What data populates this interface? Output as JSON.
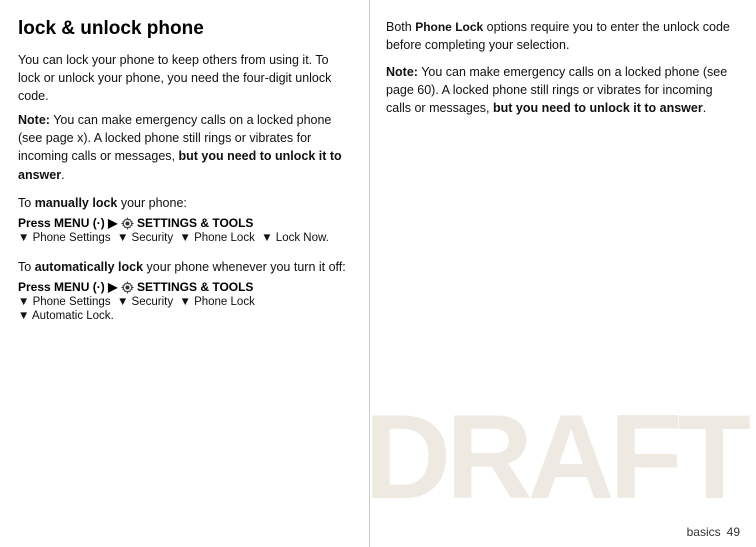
{
  "page": {
    "title": "lock & unlock phone",
    "draft_watermark": "DRAFT",
    "page_number": "49",
    "page_label": "basics"
  },
  "left": {
    "intro_p1": "You can lock your phone to keep others from using it. To lock or unlock your phone, you need the four-digit unlock code.",
    "note_label": "Note:",
    "note_p1": " You can make emergency calls on a locked phone (see page x). A locked phone still rings or vibrates for incoming calls or messages, ",
    "note_bold": "but you need to unlock it to answer",
    "note_end": ".",
    "manual_intro": "To ",
    "manual_bold": "manually lock",
    "manual_rest": " your phone:",
    "menu_press_1": "Press MENU",
    "menu_dot_1": "(·)",
    "menu_arrow_1": "▶",
    "menu_settings_1": "SETTINGS & TOOLS",
    "breadcrumb_1a": "▼ Phone Settings",
    "breadcrumb_1b": "▼ Security",
    "breadcrumb_1c": "▼ Phone Lock",
    "breadcrumb_1d": "▼ Lock Now",
    "auto_intro": "To ",
    "auto_bold": "automatically lock",
    "auto_rest": " your phone whenever you turn it off:",
    "menu_press_2": "Press MENU",
    "menu_dot_2": "(·)",
    "menu_arrow_2": "▶",
    "menu_settings_2": "SETTINGS & TOOLS",
    "breadcrumb_2a": "▼ Phone Settings",
    "breadcrumb_2b": "▼ Security",
    "breadcrumb_2c": "▼ Phone Lock",
    "breadcrumb_2d": "▼ Automatic Lock",
    "breadcrumb_2d_prefix": "▼"
  },
  "right": {
    "intro_text": "Both ",
    "phone_lock_code": "Phone Lock",
    "intro_text2": " options require you to enter the unlock code before completing your selection.",
    "note_label": "Note:",
    "note_text": " You can make emergency calls on a locked phone (see page 60). A locked phone still rings or vibrates for incoming calls or messages, ",
    "note_bold": "but you need to unlock it to answer",
    "note_end": ".",
    "page_label": "basics",
    "page_number": "49"
  }
}
